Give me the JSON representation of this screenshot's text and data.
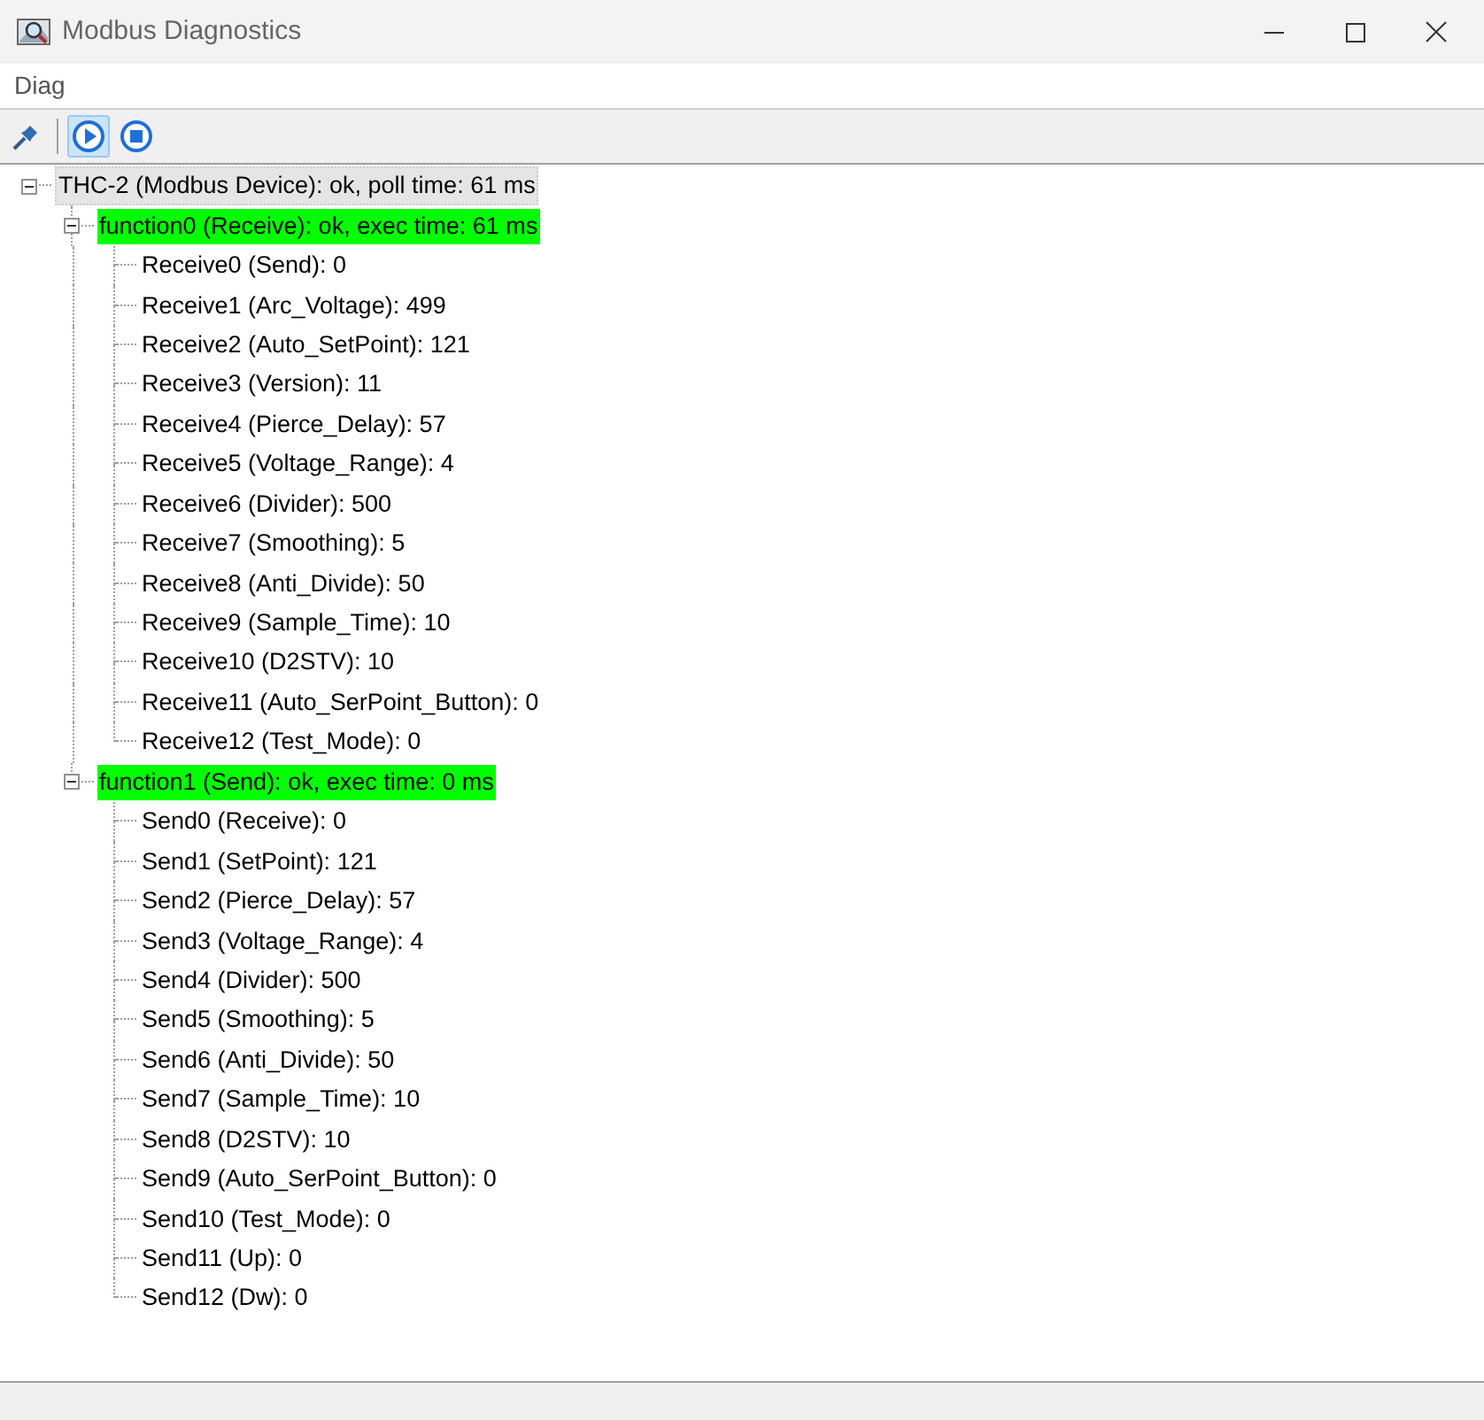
{
  "window": {
    "title": "Modbus Diagnostics"
  },
  "menu": [
    "Diag"
  ],
  "toolbar": [
    {
      "kind": "pin",
      "selected": false
    },
    {
      "kind": "separator"
    },
    {
      "kind": "play",
      "selected": true
    },
    {
      "kind": "stop",
      "selected": false
    }
  ],
  "tree": [
    {
      "label": "THC-2 (Modbus Device): ok, poll time: 61 ms",
      "selected": true,
      "highlighted": false,
      "expanded": true,
      "children": [
        {
          "label": "function0 (Receive): ok, exec time: 61 ms",
          "selected": false,
          "highlighted": true,
          "expanded": true,
          "children": [
            {
              "label": "Receive0 (Send): 0",
              "selected": false,
              "highlighted": false
            },
            {
              "label": "Receive1 (Arc_Voltage): 499",
              "selected": false,
              "highlighted": false
            },
            {
              "label": "Receive2 (Auto_SetPoint): 121",
              "selected": false,
              "highlighted": false
            },
            {
              "label": "Receive3 (Version): 11",
              "selected": false,
              "highlighted": false
            },
            {
              "label": "Receive4 (Pierce_Delay): 57",
              "selected": false,
              "highlighted": false
            },
            {
              "label": "Receive5 (Voltage_Range): 4",
              "selected": false,
              "highlighted": false
            },
            {
              "label": "Receive6 (Divider): 500",
              "selected": false,
              "highlighted": false
            },
            {
              "label": "Receive7 (Smoothing): 5",
              "selected": false,
              "highlighted": false
            },
            {
              "label": "Receive8 (Anti_Divide): 50",
              "selected": false,
              "highlighted": false
            },
            {
              "label": "Receive9 (Sample_Time): 10",
              "selected": false,
              "highlighted": false
            },
            {
              "label": "Receive10 (D2STV): 10",
              "selected": false,
              "highlighted": false
            },
            {
              "label": "Receive11 (Auto_SerPoint_Button): 0",
              "selected": false,
              "highlighted": false
            },
            {
              "label": "Receive12 (Test_Mode): 0",
              "selected": false,
              "highlighted": false
            }
          ]
        },
        {
          "label": "function1 (Send): ok, exec time: 0 ms",
          "selected": false,
          "highlighted": true,
          "expanded": true,
          "children": [
            {
              "label": "Send0 (Receive): 0",
              "selected": false,
              "highlighted": false
            },
            {
              "label": "Send1 (SetPoint): 121",
              "selected": false,
              "highlighted": false
            },
            {
              "label": "Send2 (Pierce_Delay): 57",
              "selected": false,
              "highlighted": false
            },
            {
              "label": "Send3 (Voltage_Range): 4",
              "selected": false,
              "highlighted": false
            },
            {
              "label": "Send4 (Divider): 500",
              "selected": false,
              "highlighted": false
            },
            {
              "label": "Send5 (Smoothing): 5",
              "selected": false,
              "highlighted": false
            },
            {
              "label": "Send6 (Anti_Divide): 50",
              "selected": false,
              "highlighted": false
            },
            {
              "label": "Send7 (Sample_Time): 10",
              "selected": false,
              "highlighted": false
            },
            {
              "label": "Send8 (D2STV): 10",
              "selected": false,
              "highlighted": false
            },
            {
              "label": "Send9 (Auto_SerPoint_Button): 0",
              "selected": false,
              "highlighted": false
            },
            {
              "label": "Send10 (Test_Mode): 0",
              "selected": false,
              "highlighted": false
            },
            {
              "label": "Send11 (Up): 0",
              "selected": false,
              "highlighted": false
            },
            {
              "label": "Send12 (Dw): 0",
              "selected": false,
              "highlighted": false
            }
          ]
        }
      ]
    }
  ]
}
